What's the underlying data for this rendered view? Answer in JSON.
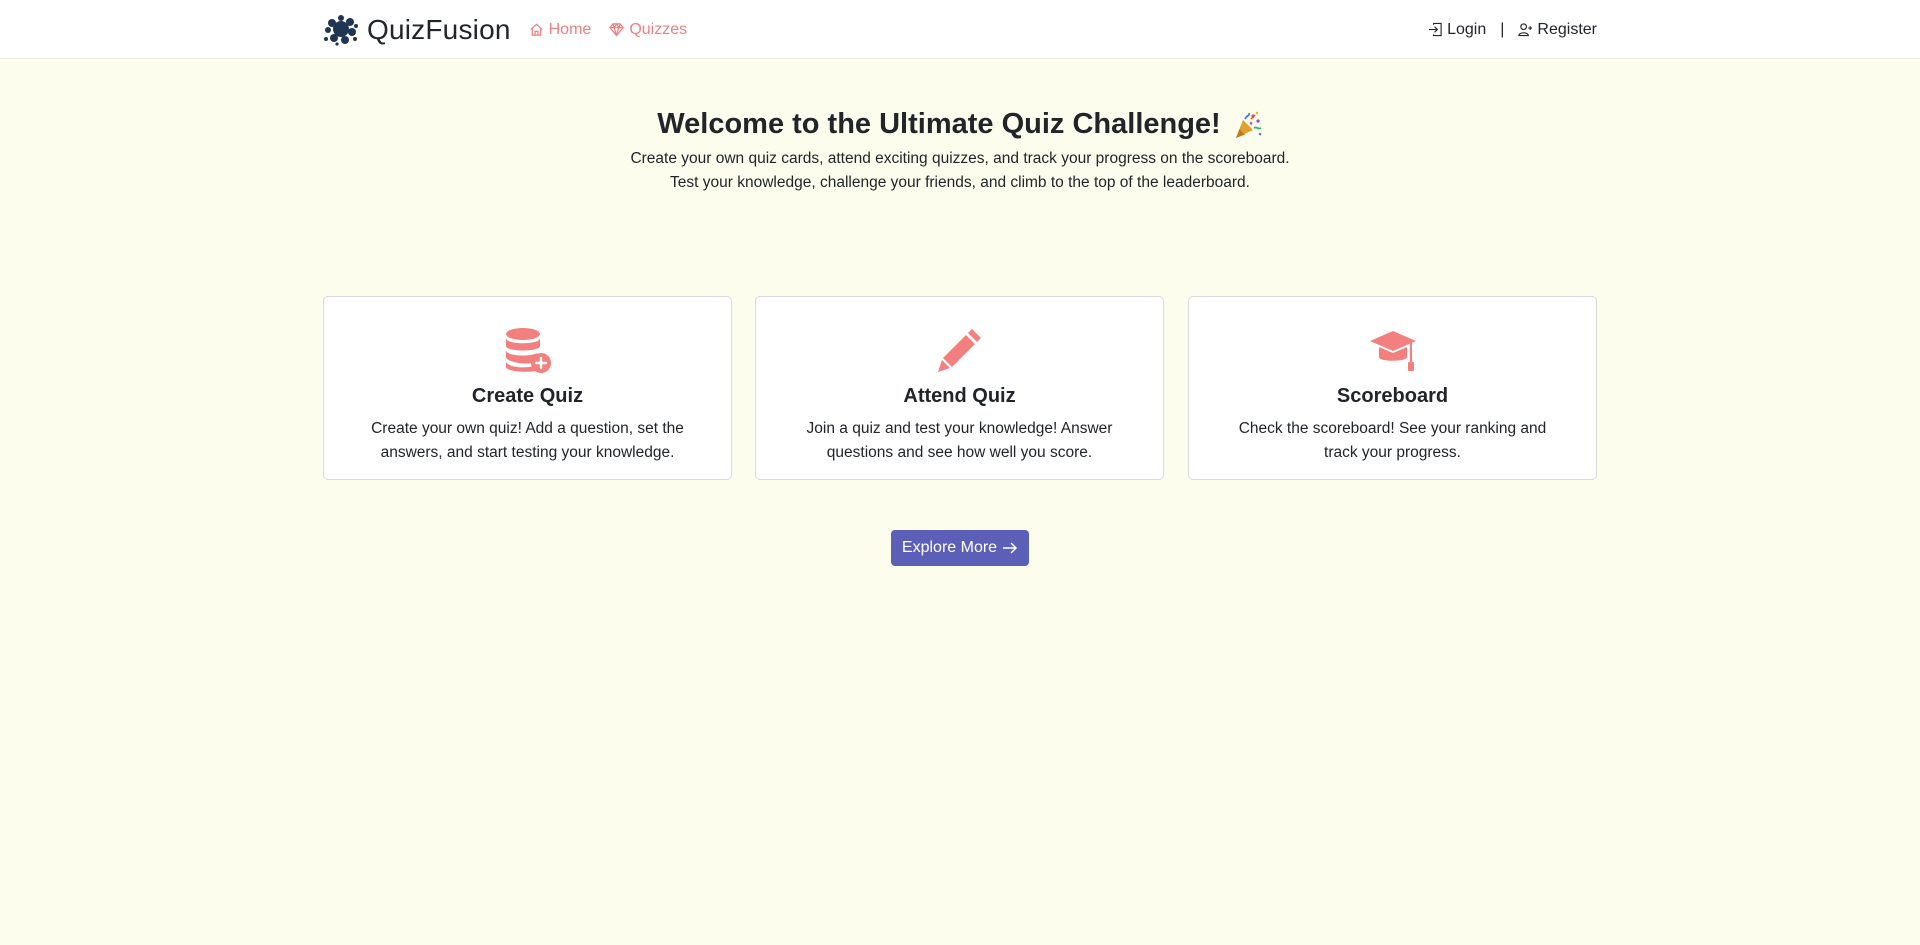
{
  "navbar": {
    "brand": "QuizFusion",
    "links": [
      {
        "label": "Home",
        "icon": "house-icon"
      },
      {
        "label": "Quizzes",
        "icon": "gem-icon"
      }
    ],
    "login_label": "Login",
    "separator": "|",
    "register_label": "Register"
  },
  "hero": {
    "title": "Welcome to the Ultimate Quiz Challenge!",
    "title_icon": "party-popper-icon",
    "line1": "Create your own quiz cards, attend exciting quizzes, and track your progress on the scoreboard.",
    "line2": "Test your knowledge, challenge your friends, and climb to the top of the leaderboard."
  },
  "cards": [
    {
      "title": "Create Quiz",
      "text": "Create your own quiz! Add a question, set the answers, and start testing your knowledge.",
      "icon": "database-add-icon"
    },
    {
      "title": "Attend Quiz",
      "text": "Join a quiz and test your knowledge! Answer questions and see how well you score.",
      "icon": "pencil-icon"
    },
    {
      "title": "Scoreboard",
      "text": "Check the scoreboard! See your ranking and track your progress.",
      "icon": "graduation-cap-icon"
    }
  ],
  "explore_button": "Explore More",
  "colors": {
    "accent": "#f08080",
    "button": "#5c5fb8",
    "background": "#fdfdee",
    "brand_logo": "#1f3554"
  }
}
